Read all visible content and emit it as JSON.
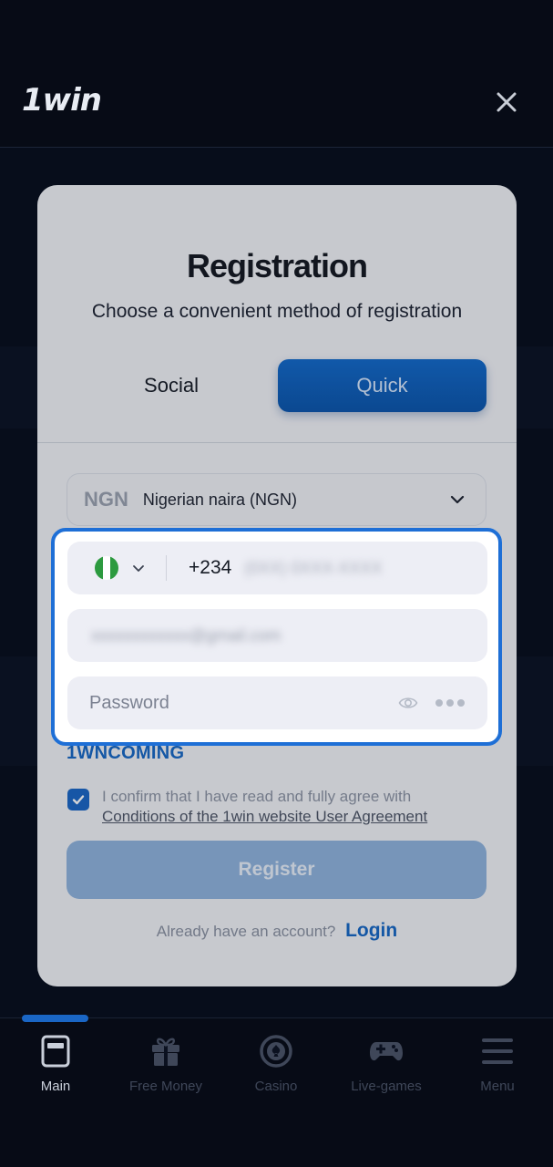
{
  "header": {
    "logo": "1win"
  },
  "modal": {
    "title": "Registration",
    "subtitle": "Choose a convenient method of registration",
    "tabs": [
      {
        "label": "Social",
        "active": false
      },
      {
        "label": "Quick",
        "active": true
      }
    ],
    "currency": {
      "code": "NGN",
      "name": "Nigerian naira (NGN)"
    },
    "phone": {
      "country": "Nigeria",
      "code": "+234",
      "number": "(0XX) 0XXX-XXXX"
    },
    "email": {
      "value": "xxxxxxxxxxxx@gmail.com"
    },
    "password": {
      "placeholder": "Password"
    },
    "promo_code": "1WNCOMING",
    "agreement": {
      "text": "I confirm that I have read and fully agree with",
      "link": "Conditions of the 1win website User Agreement",
      "checked": true
    },
    "register_label": "Register",
    "login_prompt": "Already have an account?",
    "login_link": "Login"
  },
  "bottom_nav": {
    "items": [
      {
        "label": "Main",
        "icon": "main-icon",
        "active": true
      },
      {
        "label": "Free Money",
        "icon": "gift-icon",
        "active": false
      },
      {
        "label": "Casino",
        "icon": "casino-chip-icon",
        "active": false
      },
      {
        "label": "Live-games",
        "icon": "gamepad-icon",
        "active": false
      },
      {
        "label": "Menu",
        "icon": "menu-icon",
        "active": false
      }
    ]
  },
  "colors": {
    "accent": "#1767c4",
    "highlight_border": "#1e6fd6",
    "background": "#0b1120"
  }
}
